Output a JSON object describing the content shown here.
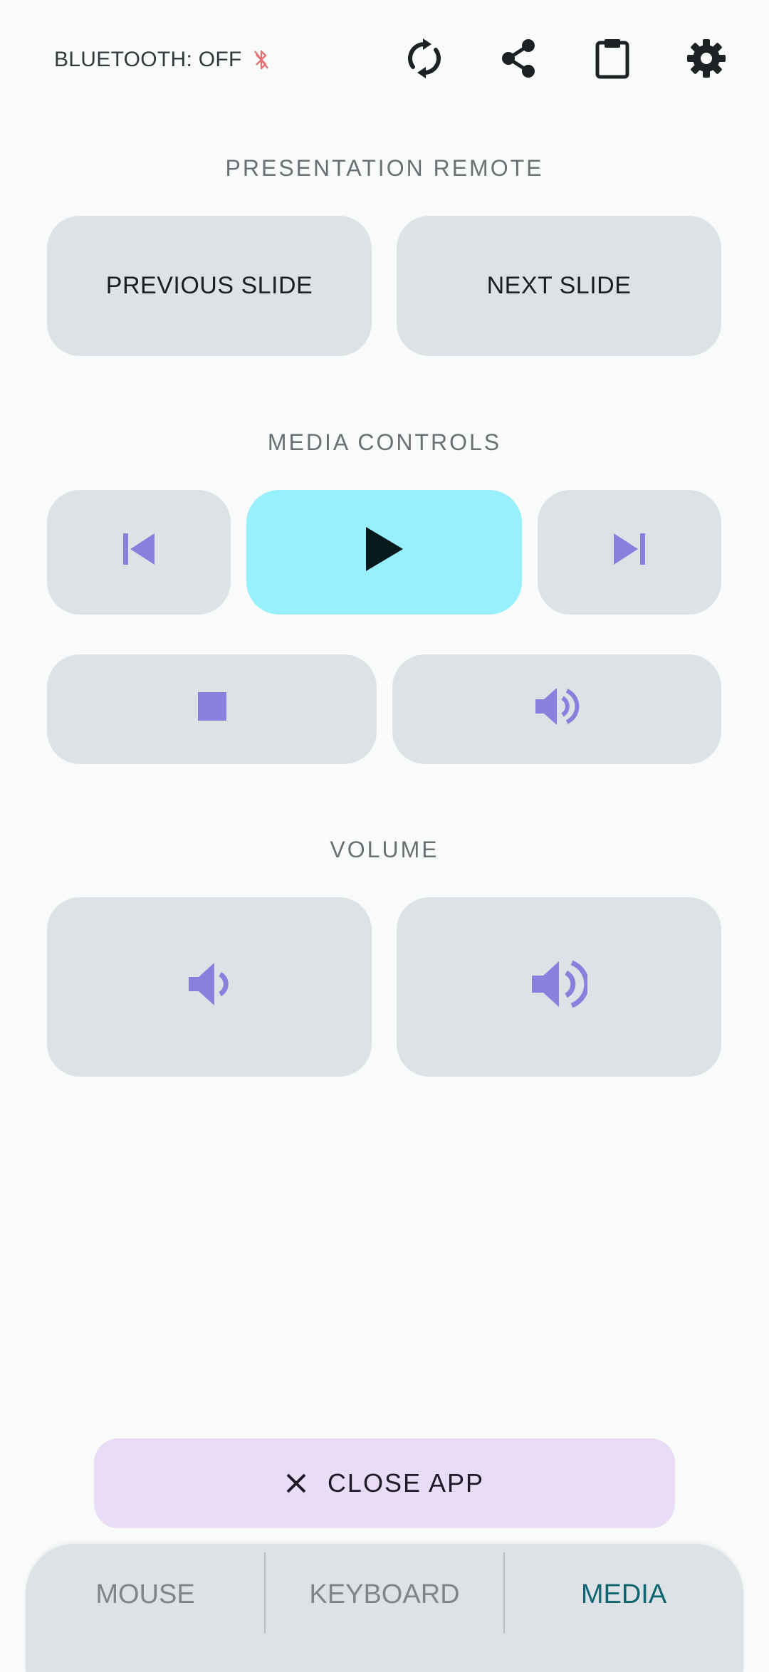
{
  "status": {
    "bluetooth_label": "BLUETOOTH: OFF",
    "bluetooth_icon": "bluetooth-disabled-icon",
    "bluetooth_icon_color": "#e57373"
  },
  "toolbar": {
    "icons": [
      "sync-icon",
      "share-icon",
      "clipboard-icon",
      "settings-icon"
    ]
  },
  "presentation": {
    "title": "PRESENTATION REMOTE",
    "previous_label": "PREVIOUS SLIDE",
    "next_label": "NEXT SLIDE"
  },
  "media": {
    "title": "MEDIA CONTROLS",
    "icons": [
      "skip-previous-icon",
      "play-icon",
      "skip-next-icon",
      "stop-icon",
      "volume-mute-icon"
    ]
  },
  "volume": {
    "title": "VOLUME",
    "icons": [
      "volume-down-icon",
      "volume-up-icon"
    ]
  },
  "close_app": {
    "label": "CLOSE APP",
    "icon": "close-icon"
  },
  "nav": {
    "items": [
      {
        "label": "MOUSE",
        "active": false
      },
      {
        "label": "KEYBOARD",
        "active": false
      },
      {
        "label": "MEDIA",
        "active": true
      }
    ]
  },
  "colors": {
    "background": "#f9fbfb",
    "button": "#dce2e6",
    "play_button": "#98f0fd",
    "icon_accent": "#8880dc",
    "close_button": "#e8dcf6",
    "nav_active": "#0f6670"
  }
}
